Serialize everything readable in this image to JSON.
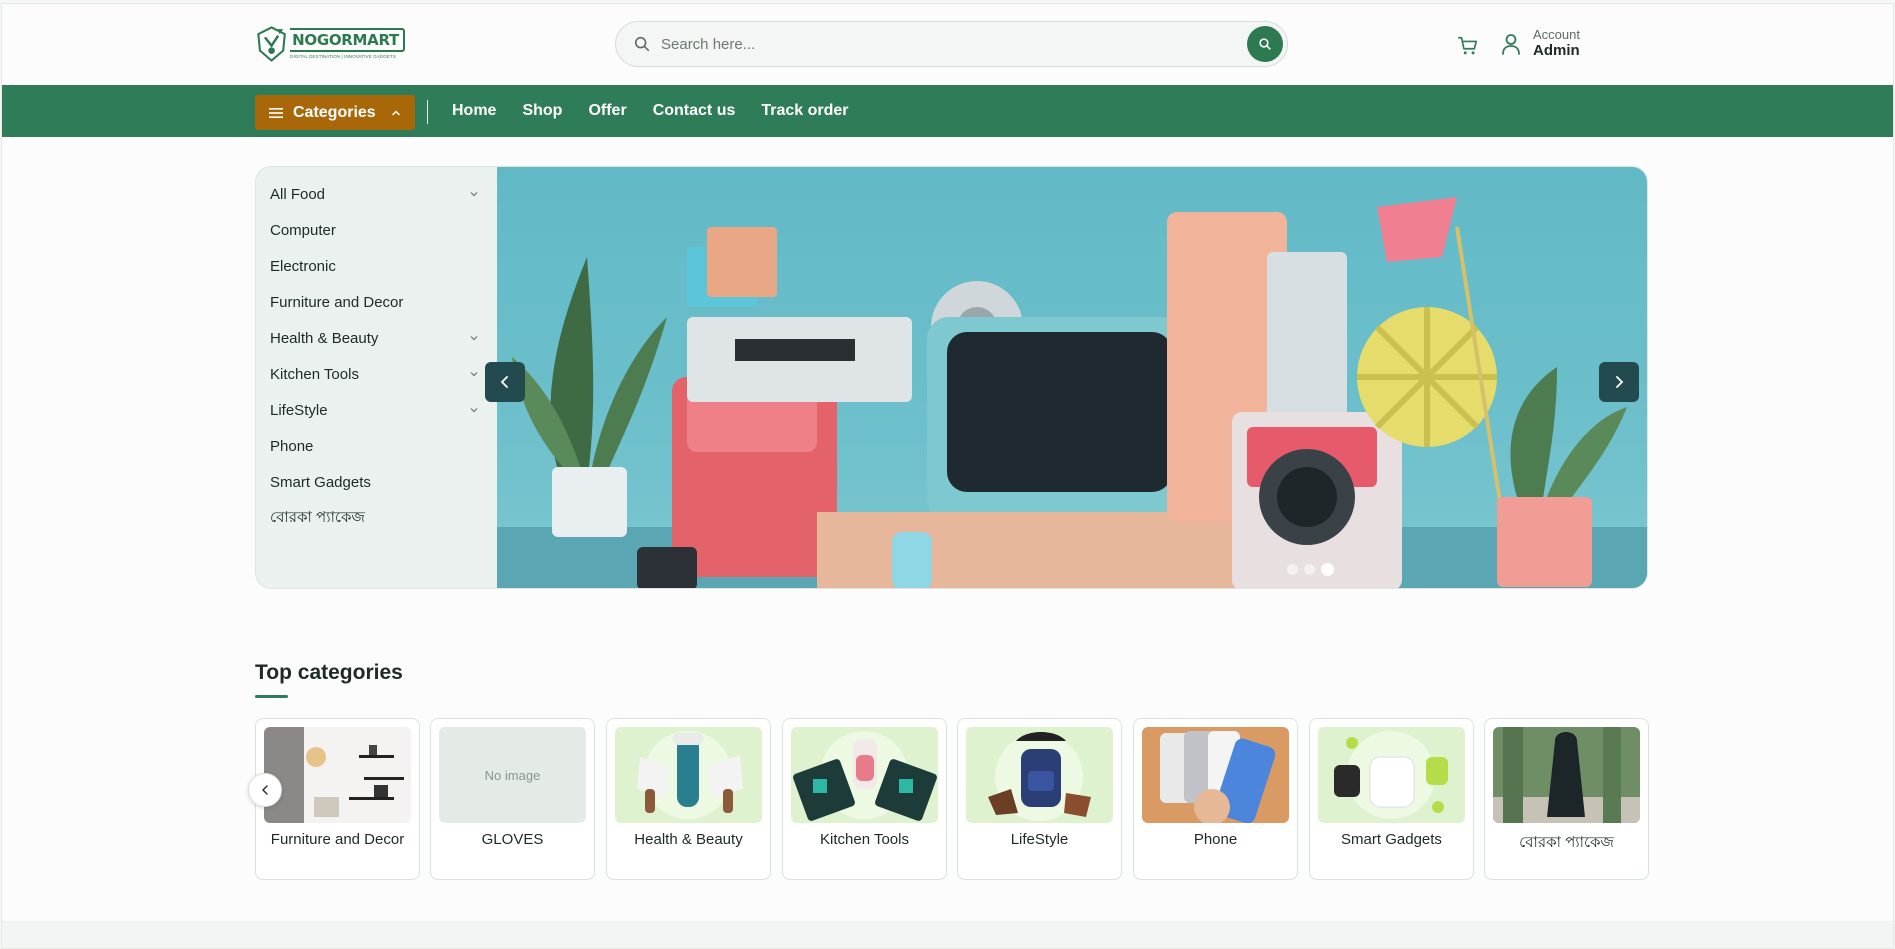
{
  "brand": {
    "name": "NOGORMART",
    "tagline": "DIGITAL DESTINATION | INNOVATIVE GADGETS",
    "color": "#2e7d58"
  },
  "search": {
    "placeholder": "Search here..."
  },
  "account": {
    "label": "Account",
    "name": "Admin"
  },
  "nav": {
    "categories_label": "Categories",
    "links": [
      "Home",
      "Shop",
      "Offer",
      "Contact us",
      "Track order"
    ]
  },
  "sidebar": {
    "items": [
      {
        "label": "All Food",
        "has_children": true
      },
      {
        "label": "Computer",
        "has_children": false
      },
      {
        "label": "Electronic",
        "has_children": false
      },
      {
        "label": "Furniture and Decor",
        "has_children": false
      },
      {
        "label": "Health & Beauty",
        "has_children": true
      },
      {
        "label": "Kitchen Tools",
        "has_children": true
      },
      {
        "label": "LifeStyle",
        "has_children": true
      },
      {
        "label": "Phone",
        "has_children": false
      },
      {
        "label": "Smart Gadgets",
        "has_children": false
      },
      {
        "label": "বোরকা প্যাকেজ",
        "has_children": false
      }
    ]
  },
  "slider": {
    "slides": 3,
    "active": 3
  },
  "top_categories": {
    "title": "Top categories",
    "items": [
      {
        "name": "Furniture and Decor",
        "image": "furniture"
      },
      {
        "name": "GLOVES",
        "image": "none",
        "placeholder": "No image"
      },
      {
        "name": "Health & Beauty",
        "image": "health"
      },
      {
        "name": "Kitchen Tools",
        "image": "kitchen"
      },
      {
        "name": "LifeStyle",
        "image": "lifestyle"
      },
      {
        "name": "Phone",
        "image": "phone"
      },
      {
        "name": "Smart Gadgets",
        "image": "gadgets"
      },
      {
        "name": "বোরকা প্যাকেজ",
        "image": "borka"
      }
    ]
  }
}
